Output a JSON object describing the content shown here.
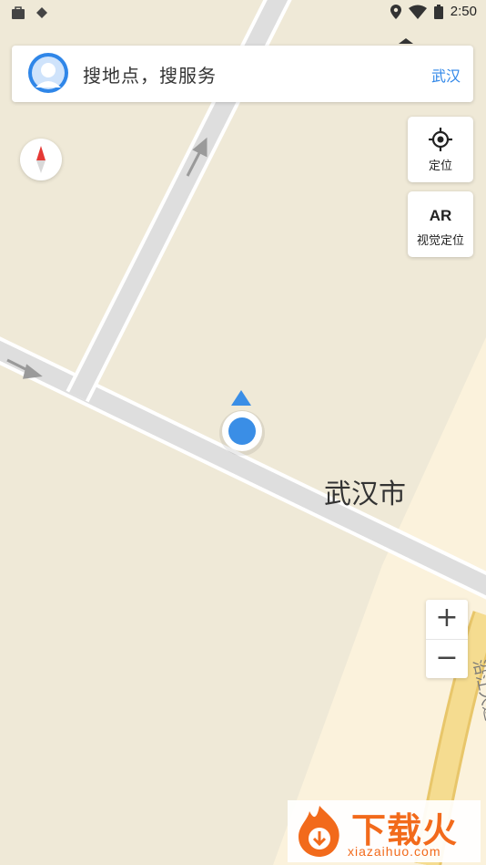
{
  "status_bar": {
    "time": "2:50",
    "left_icons": [
      "bag-icon",
      "diamond-icon"
    ],
    "right_icons": [
      "location-pin-icon",
      "wifi-icon",
      "battery-icon"
    ]
  },
  "search": {
    "placeholder": "搜地点，搜服务",
    "city": "武汉",
    "avatar_icon": "user-avatar-icon"
  },
  "controls": {
    "compass_icon": "compass-icon",
    "locate_label": "定位",
    "locate_icon": "crosshair-icon",
    "ar_title": "AR",
    "ar_label": "视觉定位",
    "zoom_in": "+",
    "zoom_out": "−"
  },
  "map": {
    "city_label": "武汉市",
    "road_label": "沿江大道",
    "colors": {
      "land": "#efe9d7",
      "land_light": "#fbf2dc",
      "road": "#dcdcdc",
      "road_edge": "#ffffff",
      "major_road": "#f2d98a",
      "location": "#3a8ee6"
    }
  },
  "watermark": {
    "title": "下载火",
    "url": "xiazaihuo.com"
  }
}
